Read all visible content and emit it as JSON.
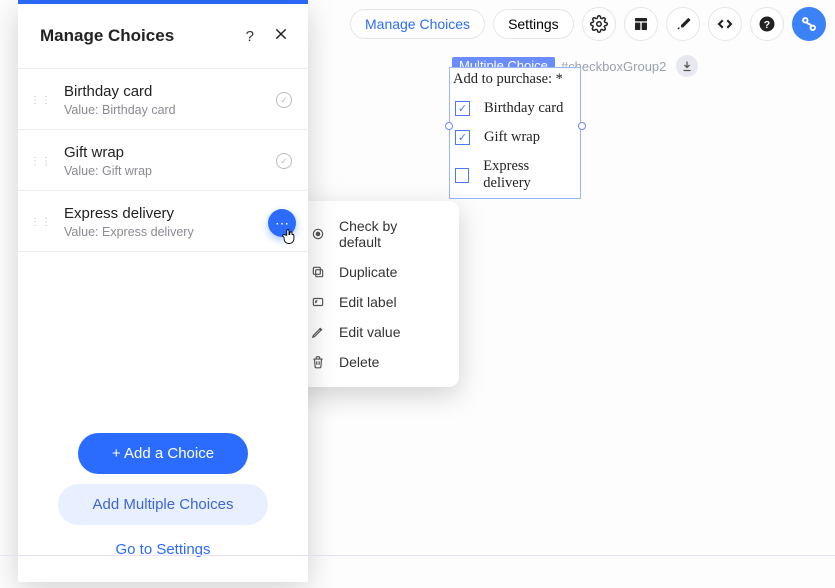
{
  "panel": {
    "title": "Manage Choices",
    "choices": [
      {
        "label": "Birthday card",
        "value_prefix": "Value: ",
        "value": "Birthday card",
        "checked": true,
        "menu_open": false
      },
      {
        "label": "Gift wrap",
        "value_prefix": "Value: ",
        "value": "Gift wrap",
        "checked": true,
        "menu_open": false
      },
      {
        "label": "Express delivery",
        "value_prefix": "Value: ",
        "value": "Express delivery",
        "checked": false,
        "menu_open": true
      }
    ],
    "add_choice": "+ Add a Choice",
    "add_multiple": "Add Multiple Choices",
    "go_to_settings": "Go to Settings"
  },
  "context_menu": {
    "items": [
      {
        "icon": "radio",
        "label": "Check by default"
      },
      {
        "icon": "duplicate",
        "label": "Duplicate"
      },
      {
        "icon": "edit-label",
        "label": "Edit label"
      },
      {
        "icon": "edit-value",
        "label": "Edit value"
      },
      {
        "icon": "delete",
        "label": "Delete"
      }
    ]
  },
  "toolbar": {
    "manage_choices": "Manage Choices",
    "settings": "Settings"
  },
  "element_tag": {
    "label": "Multiple Choice",
    "id": "#checkboxGroup2"
  },
  "preview": {
    "title": "Add to purchase: *",
    "options": [
      {
        "label": "Birthday card",
        "checked": true
      },
      {
        "label": "Gift wrap",
        "checked": true
      },
      {
        "label": "Express delivery",
        "checked": false
      }
    ]
  }
}
